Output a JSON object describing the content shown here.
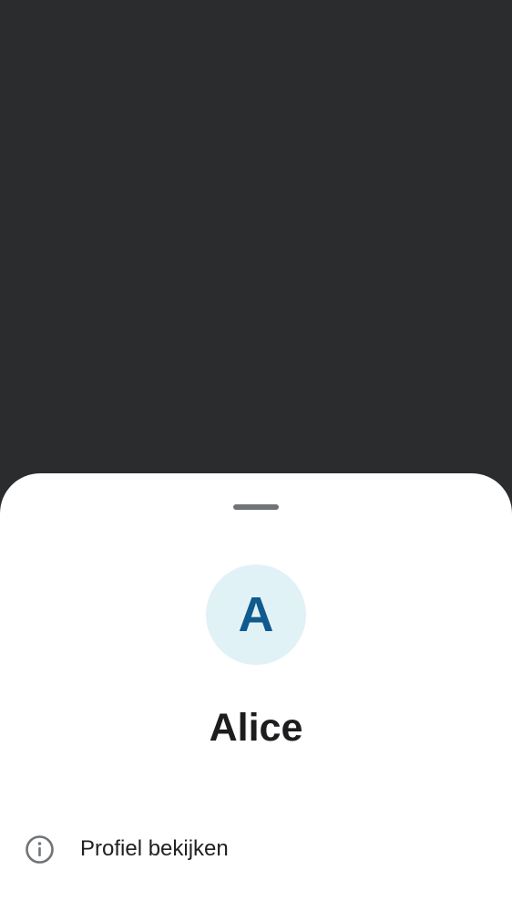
{
  "contact": {
    "initial": "A",
    "name": "Alice",
    "avatar_bg": "#e1f2f7",
    "avatar_fg": "#0f5a8e"
  },
  "actions": [
    {
      "label": "Profiel bekijken",
      "icon": "info-icon"
    }
  ],
  "colors": {
    "scrim": "#2b2c2e",
    "sheet": "#ffffff",
    "handle": "#6f7479",
    "text": "#1d1d1f"
  }
}
